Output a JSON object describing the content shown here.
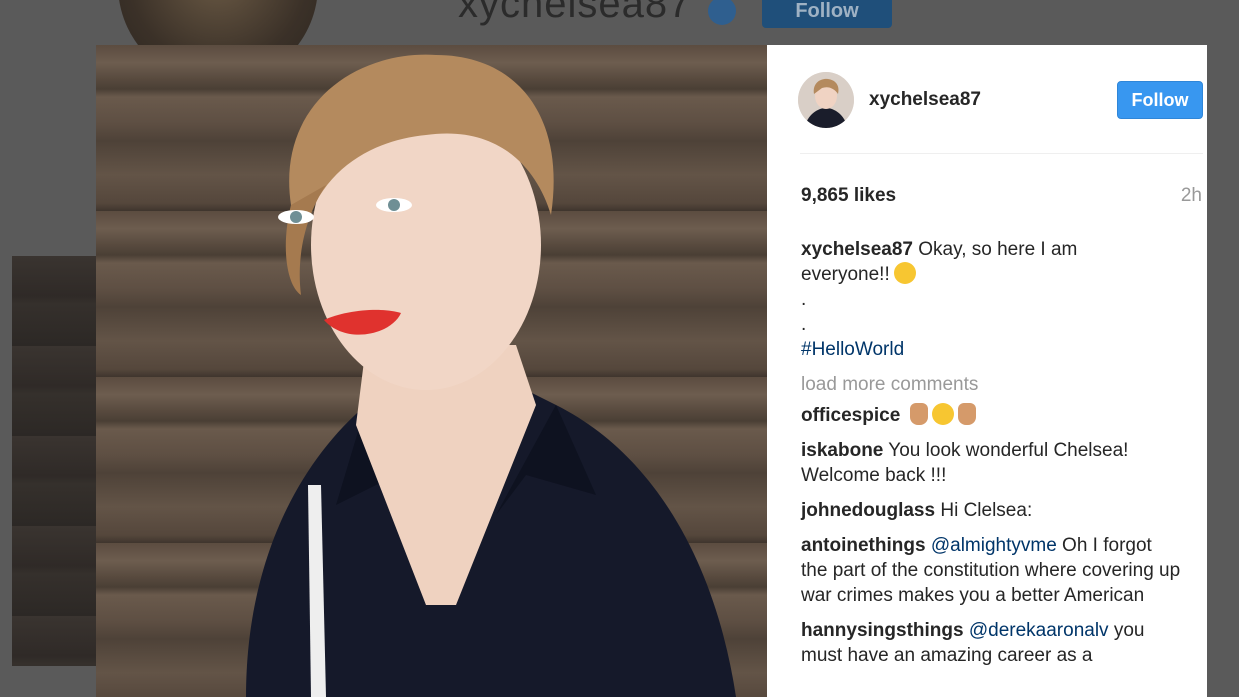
{
  "background_page": {
    "username": "xychelsea87",
    "follow_label": "Follow"
  },
  "post": {
    "username": "xychelsea87",
    "follow_label": "Follow",
    "likes": "9,865 likes",
    "time": "2h",
    "caption": {
      "user": "xychelsea87",
      "text_line1": " Okay, so here I am",
      "text_line2": "everyone!!",
      "emoji": "winking-tongue-emoji",
      "dot1": ".",
      "dot2": ".",
      "hashtag": "#HelloWorld"
    },
    "load_more": "load more comments",
    "comments": [
      {
        "user": "officespice",
        "text": "",
        "emojis": [
          "horns-hand-emoji",
          "kiss-face-emoji",
          "horns-hand-emoji"
        ]
      },
      {
        "user": "iskabone",
        "text": " You look wonderful Chelsea! Welcome back !!!"
      },
      {
        "user": "johnedouglass",
        "text": " Hi Clelsea:"
      },
      {
        "user": "antoinethings",
        "mention": "@almightyvme",
        "text": " Oh I forgot the part of the constitution where covering up war crimes makes you a better American"
      },
      {
        "user": "hannysingsthings",
        "mention": "@derekaaronalv",
        "text": " you must have an amazing career as a"
      }
    ]
  },
  "colors": {
    "follow_blue": "#3897f0",
    "link_navy": "#003569",
    "muted_gray": "#999999"
  }
}
